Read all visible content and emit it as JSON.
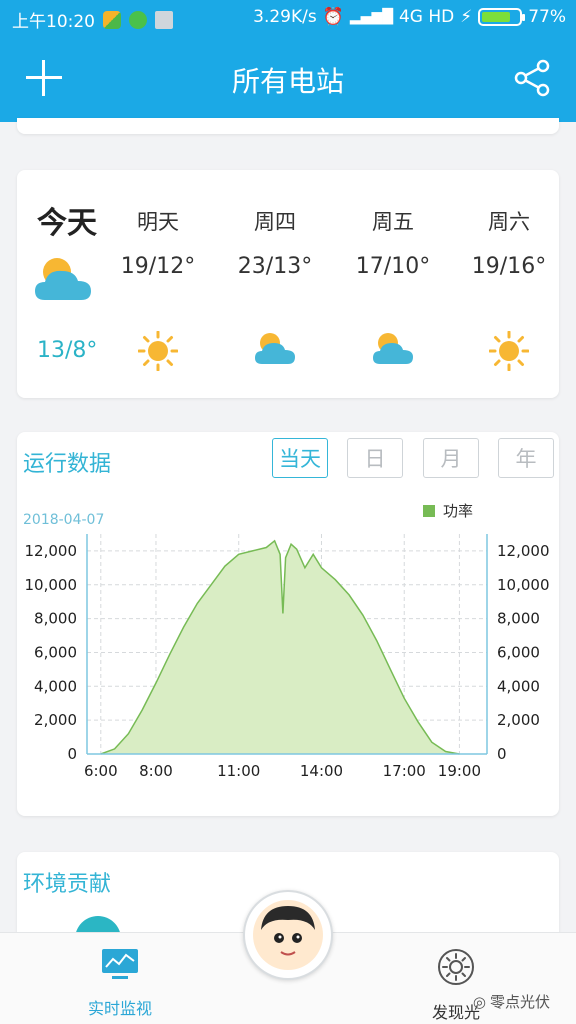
{
  "status_bar": {
    "time": "上午10:20",
    "net_speed": "3.29K/s",
    "network": "4G HD",
    "battery": "77%",
    "battery_level": 0.77
  },
  "header": {
    "title": "所有电站",
    "add_icon": "plus-icon",
    "share_icon": "share-icon"
  },
  "weather": {
    "today": {
      "label": "今天",
      "temp": "13/8°",
      "icon": "partly-cloudy-icon"
    },
    "forecast": [
      {
        "day": "明天",
        "temp": "19/12°",
        "icon": "sun-icon"
      },
      {
        "day": "周四",
        "temp": "23/13°",
        "icon": "partly-cloudy-icon"
      },
      {
        "day": "周五",
        "temp": "17/10°",
        "icon": "partly-cloudy-icon"
      },
      {
        "day": "周六",
        "temp": "19/16°",
        "icon": "sun-icon"
      }
    ]
  },
  "operation": {
    "title": "运行数据",
    "ranges": [
      "当天",
      "日",
      "月",
      "年"
    ],
    "active_range": "当天",
    "date": "2018-04-07"
  },
  "chart_data": {
    "type": "area",
    "series": [
      {
        "name": "功率",
        "color": "#77bb55",
        "points": [
          [
            6.0,
            0
          ],
          [
            6.5,
            300
          ],
          [
            7.0,
            1200
          ],
          [
            7.5,
            2600
          ],
          [
            8.0,
            4200
          ],
          [
            8.5,
            5900
          ],
          [
            9.0,
            7500
          ],
          [
            9.5,
            8900
          ],
          [
            10.0,
            10000
          ],
          [
            10.5,
            11100
          ],
          [
            11.0,
            11800
          ],
          [
            11.5,
            12000
          ],
          [
            12.0,
            12200
          ],
          [
            12.3,
            12600
          ],
          [
            12.5,
            11800
          ],
          [
            12.6,
            8300
          ],
          [
            12.7,
            11600
          ],
          [
            12.9,
            12400
          ],
          [
            13.1,
            12100
          ],
          [
            13.4,
            11000
          ],
          [
            13.7,
            11800
          ],
          [
            14.0,
            11000
          ],
          [
            14.5,
            10300
          ],
          [
            15.0,
            9400
          ],
          [
            15.5,
            8200
          ],
          [
            16.0,
            6700
          ],
          [
            16.5,
            5000
          ],
          [
            17.0,
            3300
          ],
          [
            17.5,
            1900
          ],
          [
            18.0,
            700
          ],
          [
            18.5,
            150
          ],
          [
            19.0,
            0
          ]
        ]
      }
    ],
    "x_ticks": [
      "6:00",
      "8:00",
      "11:00",
      "14:00",
      "17:00",
      "19:00"
    ],
    "y_ticks": [
      "0",
      "2,000",
      "4,000",
      "6,000",
      "8,000",
      "10,000",
      "12,000"
    ],
    "xlim": [
      5.5,
      20.0
    ],
    "ylim": [
      0,
      13000
    ],
    "grid": true,
    "legend": "top-right"
  },
  "environment": {
    "title": "环境贡献"
  },
  "bottom_nav": {
    "monitor_label": "实时监视",
    "discover_label": "发现光",
    "watermark": "零点光伏"
  }
}
